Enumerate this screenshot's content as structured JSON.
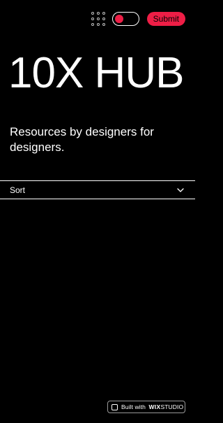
{
  "header": {
    "grid_menu_icon": "grid-dots-icon",
    "toggle_state": "off",
    "submit_label": "Submit"
  },
  "hero": {
    "title": "10X HUB",
    "subtitle": "Resources by designers for designers."
  },
  "sort": {
    "label": "Sort",
    "icon": "chevron-down-icon"
  },
  "badge": {
    "built_with": "Built with",
    "brand": "WIX",
    "brand_suffix": "STUDIO"
  },
  "colors": {
    "background": "#000000",
    "accent": "#ee1e46",
    "text": "#ffffff"
  }
}
